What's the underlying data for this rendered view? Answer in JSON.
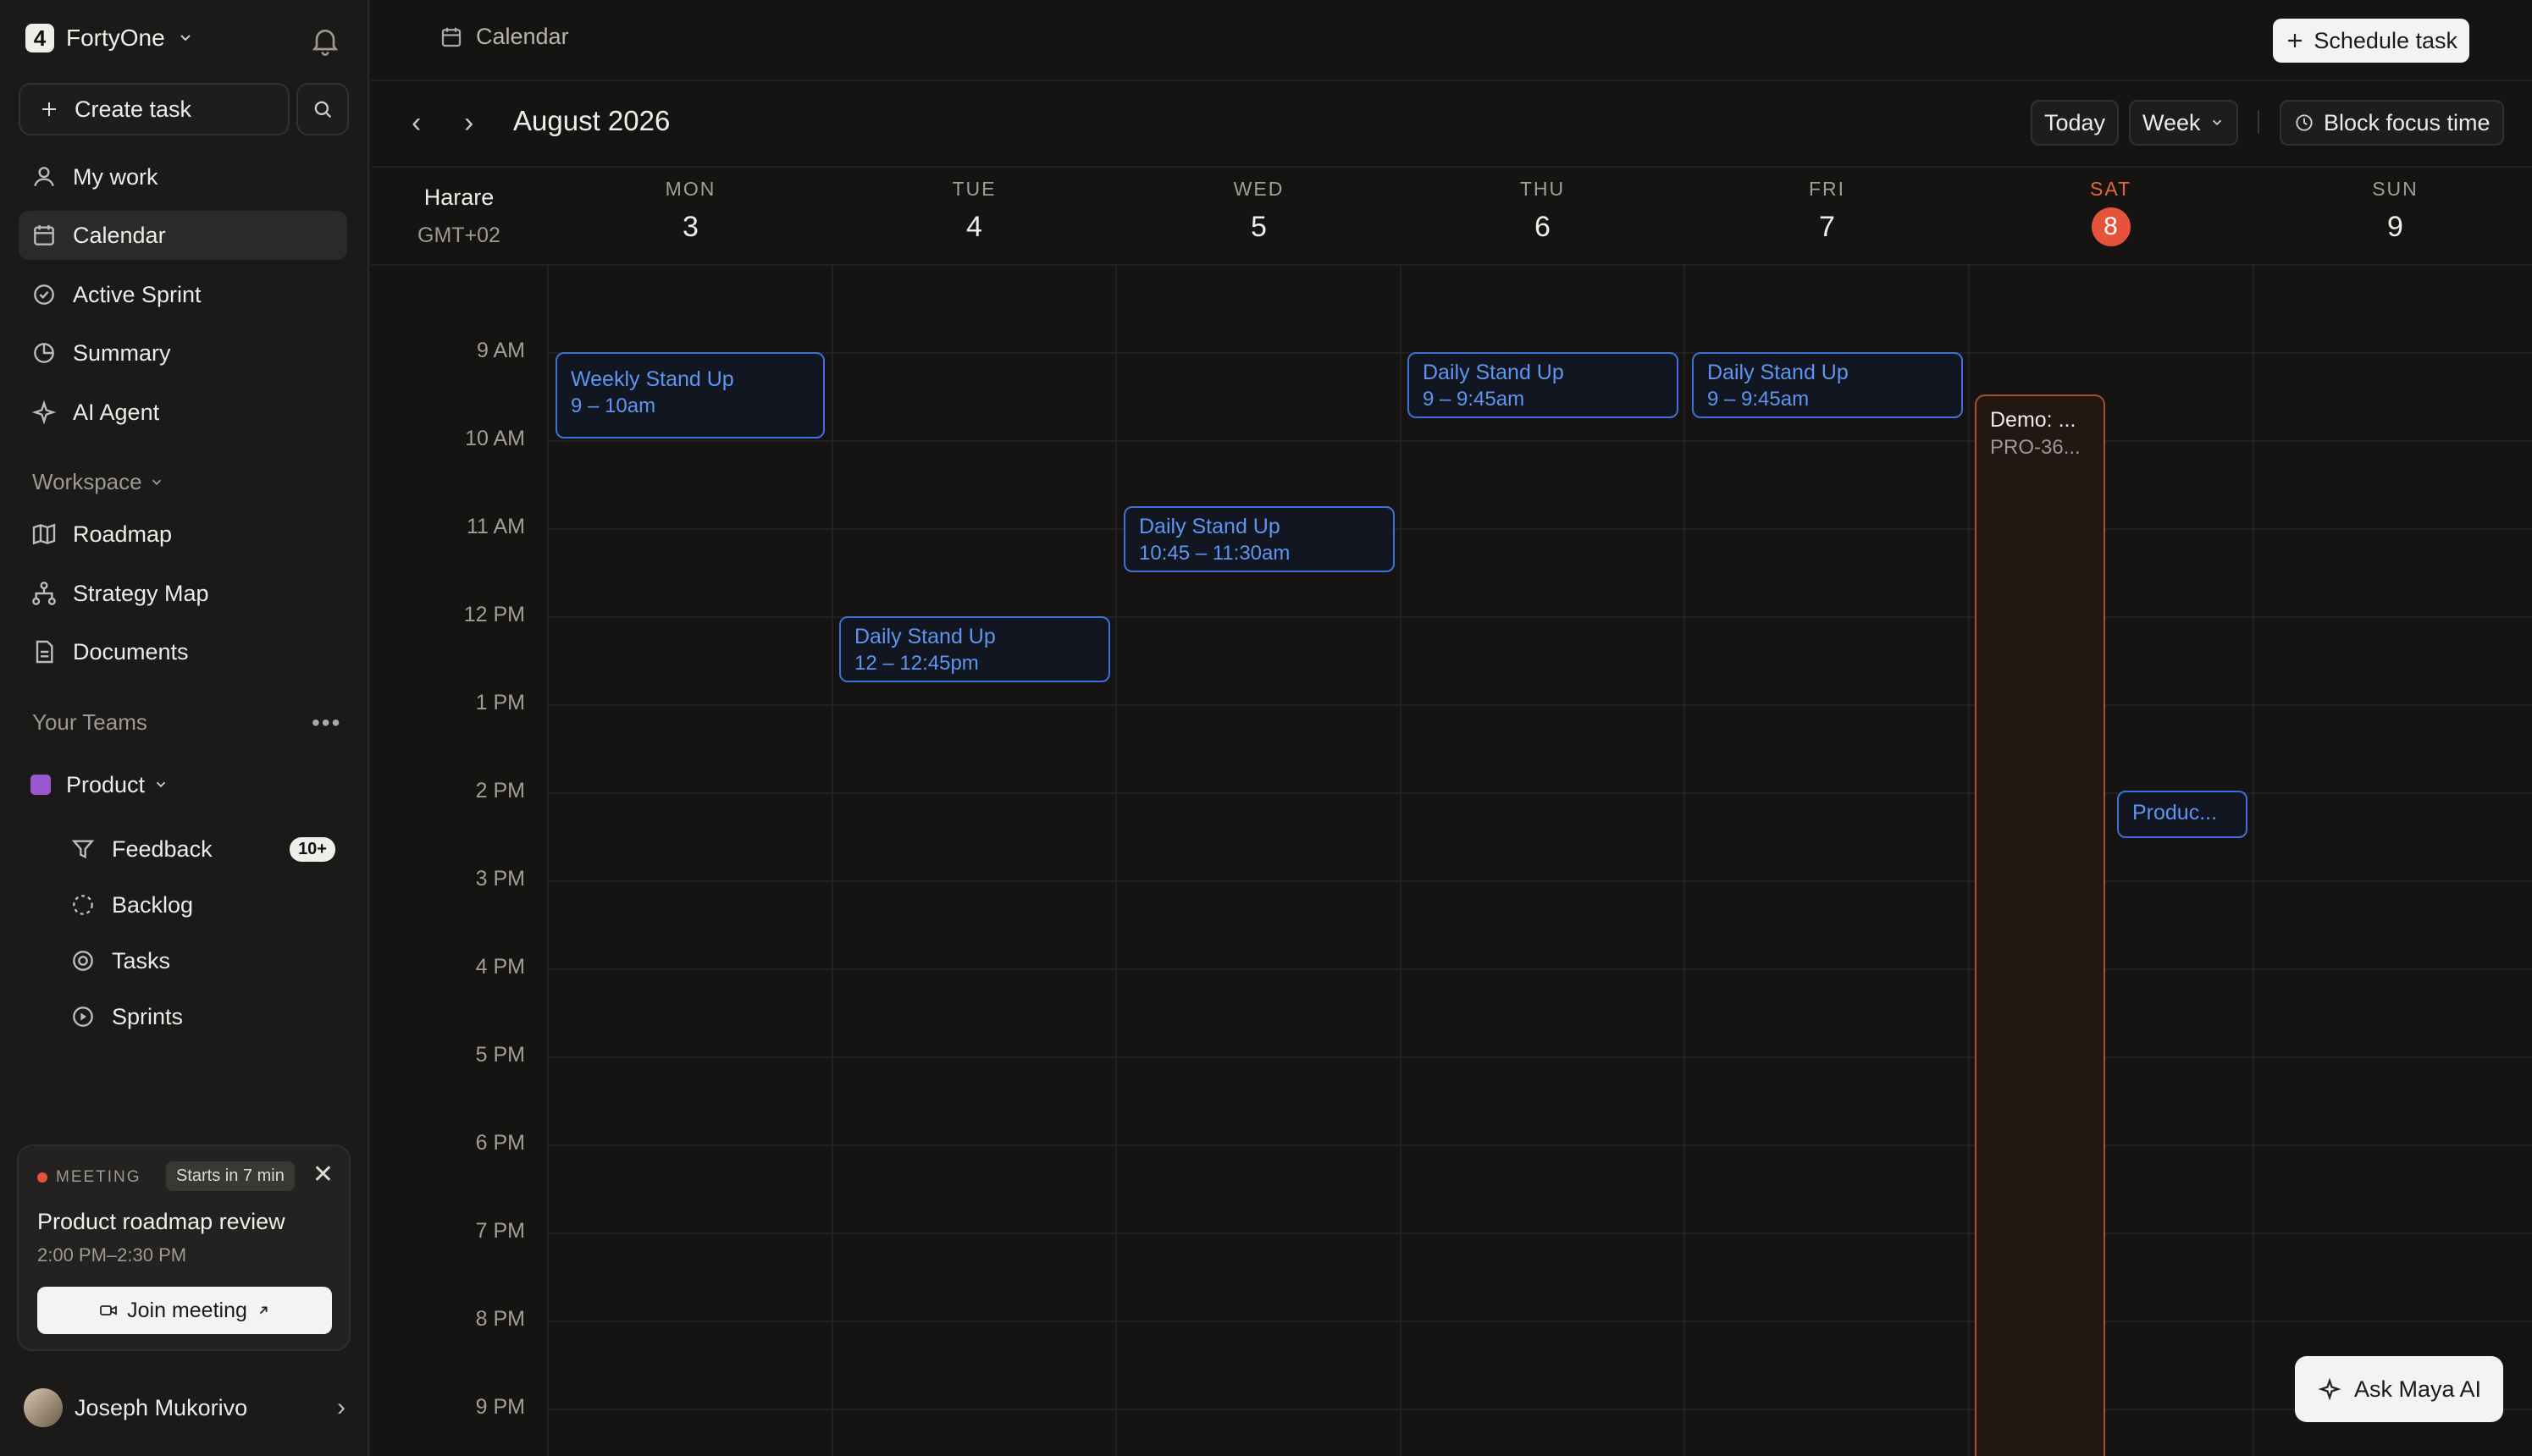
{
  "workspace": {
    "name": "FortyOne"
  },
  "sidebar": {
    "create_label": "Create task",
    "nav": [
      {
        "label": "My work"
      },
      {
        "label": "Calendar"
      },
      {
        "label": "Active Sprint"
      },
      {
        "label": "Summary"
      },
      {
        "label": "AI Agent"
      }
    ],
    "workspace_label": "Workspace",
    "workspace_items": [
      {
        "label": "Roadmap"
      },
      {
        "label": "Strategy Map"
      },
      {
        "label": "Documents"
      }
    ],
    "teams_label": "Your Teams",
    "team": {
      "name": "Product",
      "color": "#9b59d0"
    },
    "team_items": [
      {
        "label": "Feedback",
        "badge": "10+"
      },
      {
        "label": "Backlog"
      },
      {
        "label": "Tasks"
      },
      {
        "label": "Sprints"
      }
    ]
  },
  "meeting": {
    "label": "MEETING",
    "starts": "Starts in 7 min",
    "title": "Product roadmap review",
    "time": "2:00 PM–2:30 PM",
    "join_label": "Join meeting"
  },
  "user": {
    "name": "Joseph Mukorivo"
  },
  "header": {
    "breadcrumb": "Calendar",
    "schedule_label": "Schedule task"
  },
  "toolbar": {
    "month": "August 2026",
    "today_label": "Today",
    "view_label": "Week",
    "focus_label": "Block focus time"
  },
  "timezone": {
    "city": "Harare",
    "offset": "GMT+02"
  },
  "days": [
    {
      "name": "MON",
      "num": "3"
    },
    {
      "name": "TUE",
      "num": "4"
    },
    {
      "name": "WED",
      "num": "5"
    },
    {
      "name": "THU",
      "num": "6"
    },
    {
      "name": "FRI",
      "num": "7"
    },
    {
      "name": "SAT",
      "num": "8",
      "today": true
    },
    {
      "name": "SUN",
      "num": "9"
    }
  ],
  "hours": [
    "9 AM",
    "10 AM",
    "11 AM",
    "12 PM",
    "1 PM",
    "2 PM",
    "3 PM",
    "4 PM",
    "5 PM",
    "6 PM",
    "7 PM",
    "8 PM",
    "9 PM"
  ],
  "events": [
    {
      "title": "Weekly Stand Up",
      "time": "9 – 10am"
    },
    {
      "title": "Daily Stand Up",
      "time": "12 – 12:45pm"
    },
    {
      "title": "Daily Stand Up",
      "time": "10:45 – 11:30am"
    },
    {
      "title": "Daily Stand Up",
      "time": "9 – 9:45am"
    },
    {
      "title": "Daily Stand Up",
      "time": "9 – 9:45am"
    },
    {
      "title": "Demo: ...",
      "time": "PRO-36..."
    },
    {
      "title": "Produc..."
    }
  ],
  "ai": {
    "label": "Ask Maya AI"
  },
  "colors": {
    "today_accent": "#e5533a",
    "event_blue": "#3f6fd8",
    "demo_orange": "#a2512e"
  }
}
